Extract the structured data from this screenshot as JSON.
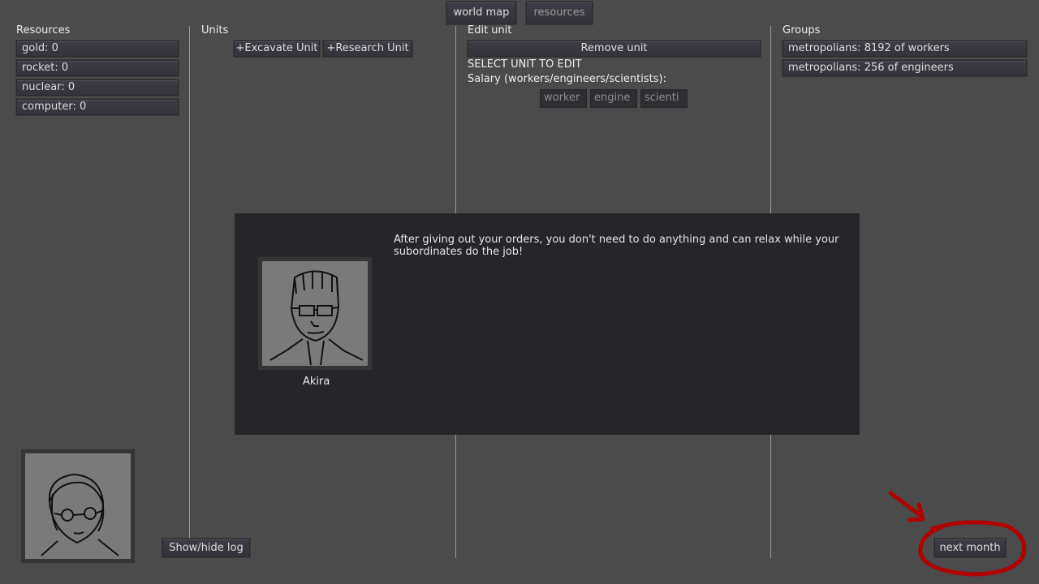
{
  "top_tabs": {
    "world_map": "world map",
    "resources": "resources"
  },
  "resources_panel": {
    "title": "Resources",
    "items": [
      "gold: 0",
      "rocket: 0",
      "nuclear: 0",
      "computer: 0"
    ]
  },
  "units_panel": {
    "title": "Units",
    "excavate_button": "+Excavate Unit",
    "research_button": "+Research Unit"
  },
  "edit_panel": {
    "title": "Edit unit",
    "remove_button": "Remove unit",
    "select_prompt": "SELECT UNIT TO EDIT",
    "salary_label": "Salary (workers/engineers/scientists):",
    "salary_fields": {
      "worker": "worker",
      "engineer": "engine",
      "scientist": "scienti"
    }
  },
  "groups_panel": {
    "title": "Groups",
    "items": [
      "metropolians: 8192 of workers",
      "metropolians: 256 of engineers"
    ]
  },
  "dialog": {
    "text": "After giving out your orders, you don't need to do anything and can relax while your subordinates do the job!",
    "speaker": "Akira"
  },
  "bottom": {
    "log_button": "Show/hide log",
    "next_button": "next month"
  },
  "annotation_color": "#b00000"
}
